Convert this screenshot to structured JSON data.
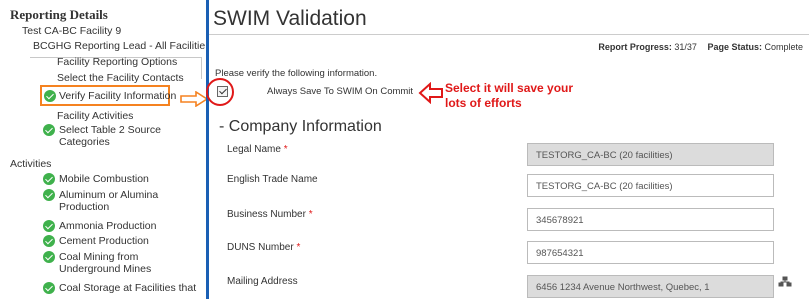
{
  "sidebar": {
    "title": "Reporting Details",
    "facility": "Test CA-BC Facility 9",
    "lead": "BCGHG Reporting Lead - All Facilities",
    "items": [
      {
        "label": "Facility Reporting Options",
        "done": false
      },
      {
        "label": "Select the Facility Contacts",
        "done": false
      },
      {
        "label": "Verify Facility Information",
        "done": true,
        "selected": true
      },
      {
        "label": "Facility Activities",
        "done": false
      },
      {
        "label": "Select Table 2 Source Categories",
        "done": true
      }
    ],
    "activities_heading": "Activities",
    "activities": [
      {
        "label": "Mobile Combustion",
        "done": true
      },
      {
        "label": "Aluminum or Alumina Production",
        "done": true
      },
      {
        "label": "Ammonia Production",
        "done": true
      },
      {
        "label": "Cement Production",
        "done": true
      },
      {
        "label": "Coal Mining from Underground Mines",
        "done": true
      },
      {
        "label": "Coal Storage at Facilities that",
        "done": true
      }
    ]
  },
  "main": {
    "title": "SWIM Validation",
    "progress_label": "Report Progress:",
    "progress_value": "31/37",
    "status_label": "Page Status:",
    "status_value": "Complete",
    "verify_text": "Please verify the following information.",
    "checkbox_label": "Always Save To SWIM On Commit",
    "checkbox_checked": true,
    "annotation_line1": "Select it will save your",
    "annotation_line2": "lots of efforts",
    "section_title": "- Company Information",
    "fields": [
      {
        "label": "Legal Name",
        "required": true,
        "value": "TESTORG_CA-BC (20 facilities)",
        "readonly": true
      },
      {
        "label": "English Trade Name",
        "required": false,
        "value": "TESTORG_CA-BC (20 facilities)",
        "readonly": false
      },
      {
        "label": "Business Number",
        "required": true,
        "value": "345678921",
        "readonly": false
      },
      {
        "label": "DUNS Number",
        "required": true,
        "value": "987654321",
        "readonly": false
      },
      {
        "label": "Mailing Address",
        "required": false,
        "value": "6456 1234 Avenue Northwest, Quebec, 1",
        "readonly": true
      }
    ],
    "required_marker": "*"
  },
  "colors": {
    "accent": "#1a5fb4",
    "highlight": "#f58220",
    "annotation": "#e01818",
    "check": "#3fb14c"
  },
  "icons": [
    "check-circle-icon",
    "arrow-left-icon",
    "lookup-icon"
  ]
}
